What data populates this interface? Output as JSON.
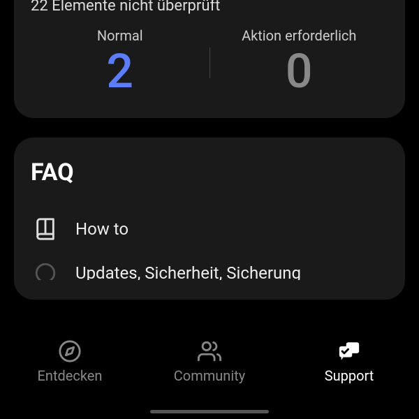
{
  "status": {
    "subtitle": "22 Elemente nicht überprüft",
    "normal_label": "Normal",
    "normal_value": "2",
    "normal_color": "#5c7cfa",
    "action_label": "Aktion erforderlich",
    "action_value": "0",
    "action_color": "#888"
  },
  "faq": {
    "title": "FAQ",
    "items": [
      {
        "label": "How to"
      },
      {
        "label": "Updates, Sicherheit, Sicherung"
      }
    ]
  },
  "nav": {
    "discover": "Entdecken",
    "community": "Community",
    "support": "Support"
  }
}
